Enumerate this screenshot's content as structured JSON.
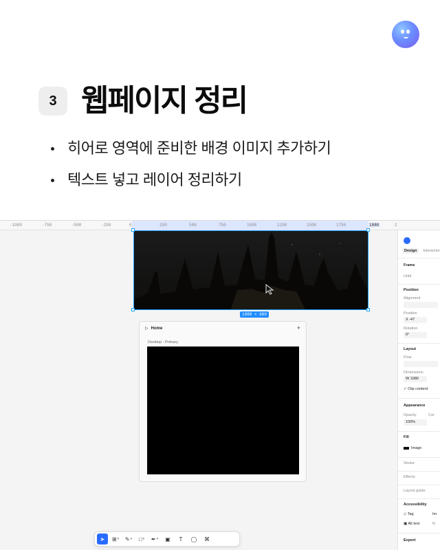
{
  "slide": {
    "step_number": "3",
    "title": "웹페이지 정리",
    "bullets": [
      "히어로 영역에 준비한 배경 이미지 추가하기",
      "텍스트 넣고 레이어 정리하기"
    ]
  },
  "ruler": {
    "labels": [
      "-1000",
      "-750",
      "-500",
      "-250",
      "0",
      "250",
      "500",
      "750",
      "1000",
      "1250",
      "1500",
      "1750",
      "1080",
      "2"
    ],
    "highlight": "1080"
  },
  "canvas": {
    "frame_size_label": "1080 × 600",
    "preview_card": {
      "title": "Home",
      "subtitle": "Desktop - Primary"
    }
  },
  "panel": {
    "tabs": [
      "Design",
      "Interactions"
    ],
    "frame_label": "Frame",
    "untitled": "Untit",
    "position": {
      "title": "Position",
      "alignment": "Alignment",
      "position_label": "Position",
      "x_value": "-47",
      "rotation_label": "Rotation",
      "rotation_value": "0°"
    },
    "layout": {
      "title": "Layout",
      "flow": "Flow",
      "dimensions": "Dimensions",
      "width_value": "1080",
      "clip_content": "Clip content"
    },
    "appearance": {
      "title": "Appearance",
      "opacity_label": "Opacity",
      "corner_label": "Cor",
      "opacity_value": "100%"
    },
    "fill": {
      "title": "Fill",
      "value": "Image"
    },
    "stroke": "Stroke",
    "effects": "Effects",
    "layout_guide": "Layout guide",
    "accessibility": {
      "title": "Accessibility",
      "tag": "Tag",
      "tag_value": "Im",
      "alt_text": "Alt text",
      "alt_value": "N"
    },
    "export": "Export"
  },
  "colors": {
    "selection": "#1fa3ff",
    "accent": "#2a6bff"
  },
  "icons": {
    "logo": "smiley-logo-icon",
    "cursor": "pointer-cursor-icon"
  }
}
